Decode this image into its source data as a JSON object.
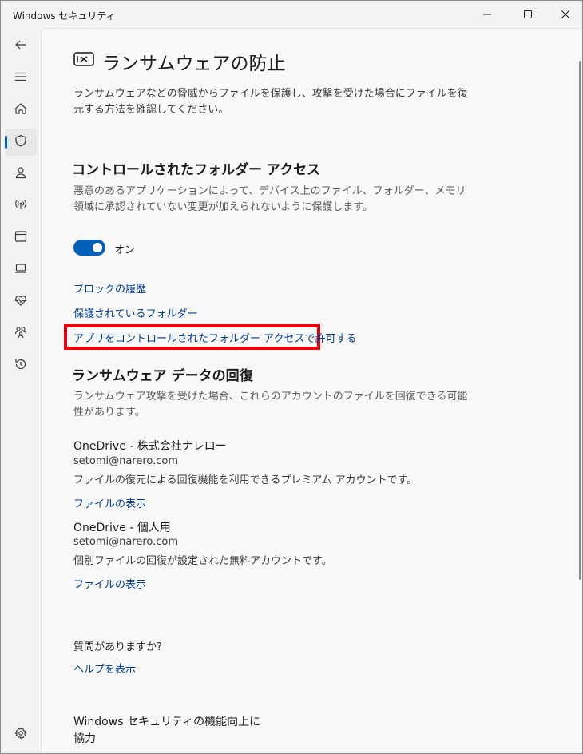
{
  "window": {
    "title": "Windows セキュリティ"
  },
  "titlebar_buttons": {
    "minimize_icon": "minimize-icon",
    "maximize_icon": "maximize-icon",
    "close_icon": "close-icon"
  },
  "nav": {
    "items": [
      {
        "name": "back",
        "icon": "back-arrow-icon"
      },
      {
        "name": "menu",
        "icon": "hamburger-icon"
      },
      {
        "name": "home",
        "icon": "home-icon"
      },
      {
        "name": "virus-protection",
        "icon": "shield-icon",
        "selected": true
      },
      {
        "name": "account-protection",
        "icon": "person-icon"
      },
      {
        "name": "firewall",
        "icon": "wireless-icon"
      },
      {
        "name": "app-browser-control",
        "icon": "browser-window-icon"
      },
      {
        "name": "device-security",
        "icon": "laptop-icon"
      },
      {
        "name": "device-performance",
        "icon": "heart-pulse-icon"
      },
      {
        "name": "family-options",
        "icon": "family-icon"
      },
      {
        "name": "protection-history",
        "icon": "history-icon"
      },
      {
        "name": "settings",
        "icon": "gear-icon"
      }
    ]
  },
  "page": {
    "icon": "ransomware-icon",
    "title": "ランサムウェアの防止",
    "description": "ランサムウェアなどの脅威からファイルを保護し、攻撃を受けた場合にファイルを復元する方法を確認してください。"
  },
  "cfa": {
    "heading": "コントロールされたフォルダー アクセス",
    "description": "悪意のあるアプリケーションによって、デバイス上のファイル、フォルダー、メモリ領域に承認されていない変更が加えられないように保護します。",
    "toggle_label": "オン",
    "toggle_on": true,
    "links": {
      "block_history": "ブロックの履歴",
      "protected_folders": "保護されているフォルダー",
      "allow_app": "アプリをコントロールされたフォルダー アクセスで許可する"
    },
    "highlight_color": "#e8000b"
  },
  "recovery": {
    "heading": "ランサムウェア データの回復",
    "description": "ランサムウェア攻撃を受けた場合、これらのアカウントのファイルを回復できる可能性があります。",
    "accounts": [
      {
        "name": "OneDrive - 株式会社ナレロー",
        "email": "setomi@narero.com",
        "detail": "ファイルの復元による回復機能を利用できるプレミアム アカウントです。",
        "link": "ファイルの表示"
      },
      {
        "name": "OneDrive - 個人用",
        "email": "setomi@narero.com",
        "detail": "個別ファイルの回復が設定された無料アカウントです。",
        "link": "ファイルの表示"
      }
    ]
  },
  "help": {
    "question": "質問がありますか?",
    "link": "ヘルプを表示"
  },
  "improve": {
    "text": "Windows セキュリティの機能向上に協力"
  },
  "colors": {
    "accent": "#005fb8",
    "link": "#003e92"
  }
}
